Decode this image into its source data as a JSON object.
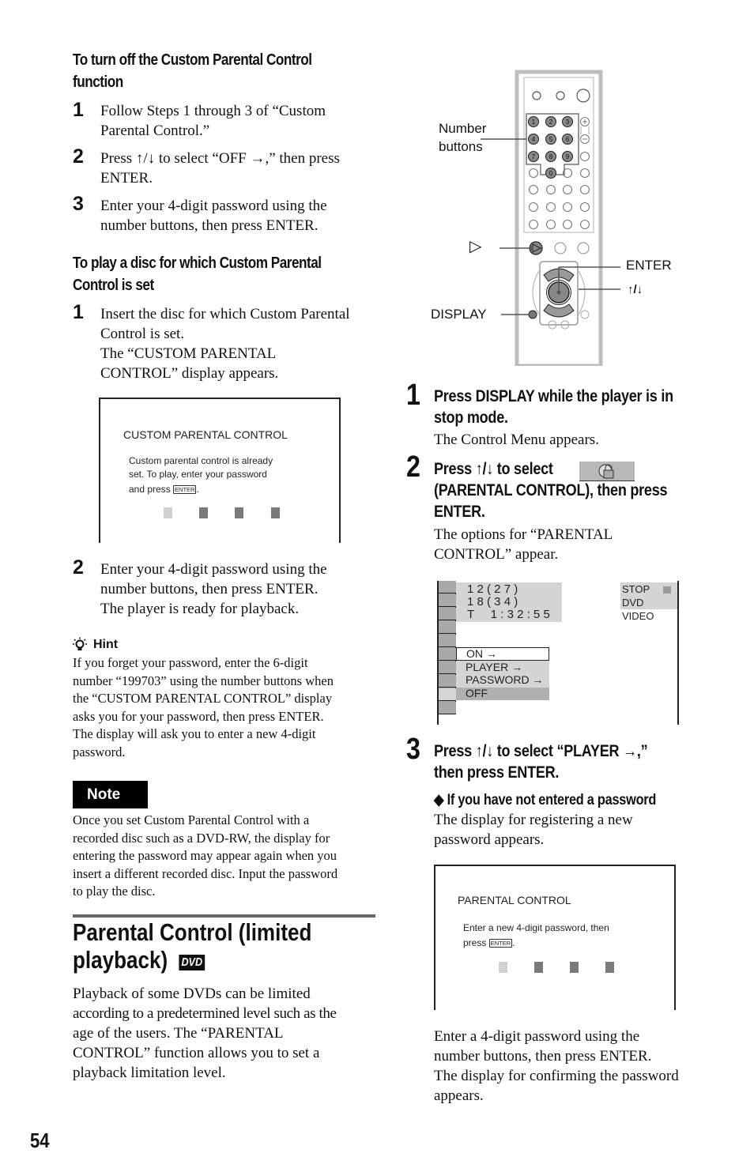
{
  "page_number": "54",
  "left": {
    "turn_off": {
      "heading": [
        "To turn off the Custom Parental Control",
        "function"
      ],
      "steps": [
        {
          "num": "1",
          "lines": [
            "Follow Steps 1 through 3 of “Custom",
            "Parental Control.”"
          ]
        },
        {
          "num": "2",
          "lines": [
            "Press ↑/↓ to select “OFF →,” then press",
            "ENTER."
          ]
        },
        {
          "num": "3",
          "lines": [
            "Enter your 4-digit password using the",
            "number buttons, then press ENTER."
          ]
        }
      ]
    },
    "play_disc": {
      "heading": [
        "To play a disc for which Custom Parental",
        "Control is set"
      ],
      "steps": [
        {
          "num": "1",
          "lines": [
            "Insert the disc for which Custom Parental",
            "Control is set.",
            "The “CUSTOM PARENTAL",
            "CONTROL” display appears."
          ]
        },
        {
          "num": "2",
          "lines": [
            "Enter your 4-digit password using the",
            "number buttons, then press ENTER.",
            "The player is ready for playback."
          ]
        }
      ]
    },
    "custom_osd": {
      "title": "CUSTOM PARENTAL CONTROL",
      "lines": [
        "Custom parental control is already",
        "set. To play, enter your password",
        "and press"
      ],
      "enter_key": "ENTER",
      "password_filled": 0,
      "password_length": 4
    },
    "hint": {
      "label": "Hint",
      "lines": [
        "If you forget your password, enter the 6-digit",
        "number “199703” using the number buttons when",
        "the “CUSTOM PARENTAL CONTROL” display",
        "asks you for your password, then press ENTER.",
        "The display will ask you to enter a new 4-digit",
        "password."
      ]
    },
    "note": {
      "label": "Note",
      "lines": [
        "Once you set Custom Parental Control with a",
        "recorded disc such as a DVD-RW, the display for",
        "entering the password may appear again when you",
        "insert a different recorded disc. Input the password",
        "to play the disc."
      ]
    },
    "section": {
      "title": [
        "Parental Control (limited",
        "playback)"
      ],
      "badge": "DVD",
      "paragraph": [
        "Playback of some DVDs can be limited",
        "according to a predetermined level such as the",
        "age of the users. The “PARENTAL",
        "CONTROL” function allows you to set a",
        "playback limitation level."
      ]
    }
  },
  "right": {
    "remote": {
      "labels": {
        "number_buttons": [
          "Number",
          "buttons"
        ],
        "play": "▷",
        "enter": "ENTER",
        "arrows": "↑/↓",
        "display": "DISPLAY"
      },
      "digits": [
        "1",
        "2",
        "3",
        "4",
        "5",
        "6",
        "7",
        "8",
        "9",
        "0"
      ]
    },
    "steps": [
      {
        "num": "1",
        "heading": [
          "Press DISPLAY while the player is in",
          "stop mode."
        ],
        "body": [
          "The Control Menu appears."
        ]
      },
      {
        "num": "2",
        "heading": [
          "Press ↑/↓ to select",
          "(PARENTAL CONTROL), then press",
          "ENTER."
        ],
        "icon": "parental-lock-icon",
        "body": [
          "The options for “PARENTAL",
          "CONTROL” appear."
        ]
      },
      {
        "num": "3",
        "heading": [
          "Press ↑/↓ to select “PLAYER →,”",
          "then press ENTER."
        ],
        "sub_heading": "◆ If you have not entered a password",
        "body": [
          "The display for registering a new",
          "password appears."
        ]
      }
    ],
    "control_menu": {
      "info": [
        "1 2 ( 2 7 )",
        "1 8 ( 3 4 )",
        "T     1 : 3 2 : 5 5"
      ],
      "status": [
        "STOP",
        "DVD VIDEO"
      ],
      "options": [
        "ON →",
        "PLAYER →",
        "PASSWORD →",
        "OFF"
      ],
      "selected_option": "ON →",
      "highlighted_option": "OFF"
    },
    "pc_osd": {
      "title": "PARENTAL CONTROL",
      "lines": [
        "Enter a new 4-digit password, then",
        "press"
      ],
      "enter_key": "ENTER",
      "password_filled": 0,
      "password_length": 4
    },
    "closing": [
      "Enter a 4-digit password using the",
      "number buttons, then press ENTER.",
      "The display for confirming the password",
      "appears."
    ]
  }
}
